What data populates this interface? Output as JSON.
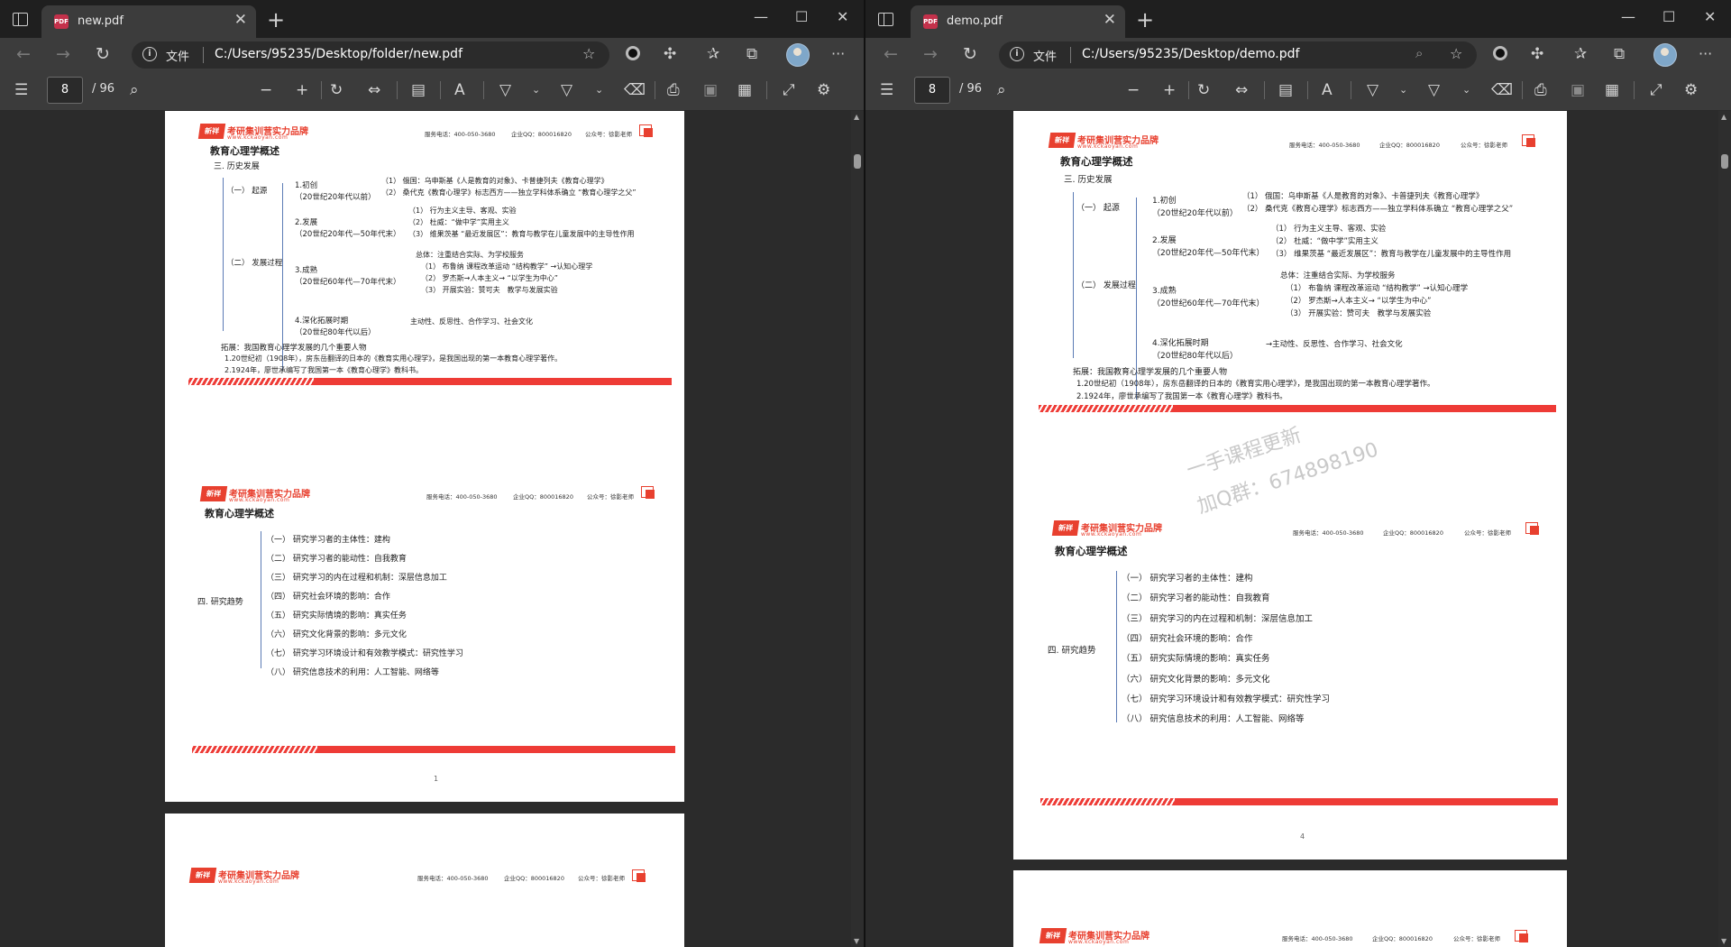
{
  "windows": [
    {
      "tab_title": "new.pdf",
      "scheme_label": "文件",
      "url": "C:/Users/95235/Desktop/folder/new.pdf",
      "page_input": "8",
      "page_total": "/ 96"
    },
    {
      "tab_title": "demo.pdf",
      "scheme_label": "文件",
      "url": "C:/Users/95235/Desktop/demo.pdf",
      "page_input": "8",
      "page_total": "/ 96"
    }
  ],
  "icons": {
    "tab_close": "✕",
    "new_tab": "+",
    "minimize": "—",
    "maximize": "☐",
    "close": "✕",
    "back": "←",
    "forward": "→",
    "refresh": "↻",
    "more": "···",
    "pdf_badge": "PDF"
  },
  "pdf": {
    "logo_mark": "新祥",
    "logo_name": "考研集训营实力品牌",
    "logo_web": "www.kckaoyan.com",
    "hotline": "服务电话：400-050-3680",
    "qq": "企业QQ：800016820",
    "wechat": "公众号：徐影老师",
    "page1": {
      "title": "教育心理学概述",
      "section": "三. 历史发展",
      "origin": "（一） 起源",
      "process": "（二） 发展过程",
      "b1_title": "1.初创",
      "b1_sub": "（20世纪20年代以前）",
      "b1_i1": "（1） 俄国：乌申斯基《人是教育的对象》、卡普捷列夫《教育心理学》",
      "b1_i2": "（2） 桑代克《教育心理学》标志西方——独立学科体系确立 “教育心理学之父”",
      "b2_title": "2.发展",
      "b2_sub": "（20世纪20年代—50年代末）",
      "b2_i1": "（1） 行为主义主导、客观、实验",
      "b2_i2": "（2） 杜威：“做中学”实用主义",
      "b2_i3": "（3） 维果茨基 “最近发展区”：教育与教学在儿童发展中的主导性作用",
      "b3_title": "3.成熟",
      "b3_sub": "（20世纪60年代—70年代末）",
      "b3_i0": "总体：注重结合实际、为学校服务",
      "b3_i1": "（1） 布鲁纳 课程改革运动 “结构教学” →认知心理学",
      "b3_i2": "（2） 罗杰斯→人本主义→ “以学生为中心”",
      "b3_i3": "（3） 开展实验：赞可夫　教学与发展实验",
      "b4_title": "4.深化拓展时期",
      "b4_sub": "（20世纪80年代以后）",
      "b4_i1": "主动性、反思性、合作学习、社会文化",
      "b4_i1_arrow": "→主动性、反思性、合作学习、社会文化",
      "ext_title": "拓展：我国教育心理学发展的几个重要人物",
      "ext_1": "1.20世纪初（1908年），房东岳翻译的日本的《教育实用心理学》，是我国出现的第一本教育心理学著作。",
      "ext_2": "2.1924年，廖世承编写了我国第一本《教育心理学》教科书。"
    },
    "page2": {
      "title": "教育心理学概述",
      "section": "四. 研究趋势",
      "items": [
        "（一） 研究学习者的主体性：建构",
        "（二） 研究学习者的能动性：自我教育",
        "（三） 研究学习的内在过程和机制：深层信息加工",
        "（四） 研究社会环境的影响：合作",
        "（五） 研究实际情境的影响：真实任务",
        "（六） 研究文化背景的影响：多元文化",
        "（七） 研究学习环境设计和有效教学模式：研究性学习",
        "（八） 研究信息技术的利用：人工智能、网络等"
      ],
      "page_number_left": "1",
      "page_number_right": "4"
    },
    "watermark_line1": "一手课程更新",
    "watermark_line2": "加Q群：674898190"
  }
}
